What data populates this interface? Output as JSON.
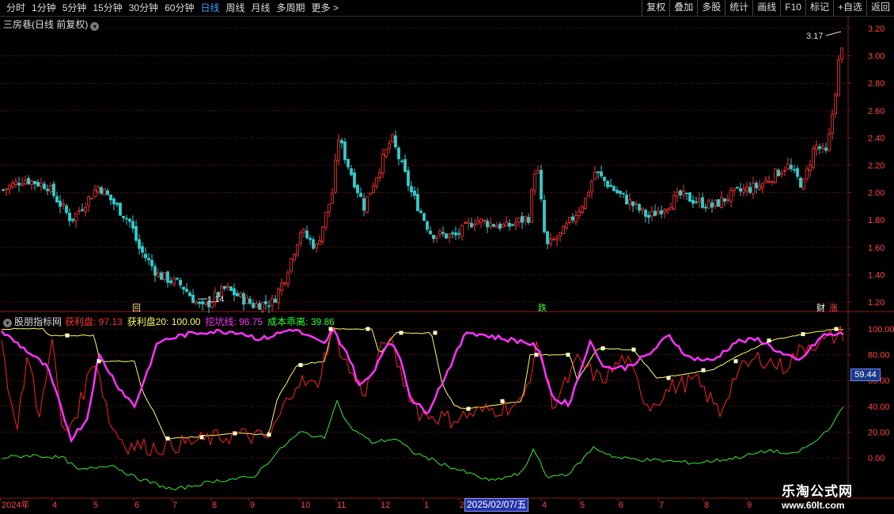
{
  "toolbar": {
    "periods": [
      "分时",
      "1分钟",
      "5分钟",
      "15分钟",
      "30分钟",
      "60分钟",
      "日线",
      "周线",
      "月线",
      "多周期",
      "更多 >"
    ],
    "active_period": "日线",
    "right_buttons": [
      "复权",
      "叠加",
      "多股",
      "统计",
      "画线",
      "F10",
      "标记",
      "+自选",
      "返回"
    ]
  },
  "stock": {
    "title": "三房巷(日线 前复权)"
  },
  "price_axis": {
    "ticks": [
      "3.20",
      "3.00",
      "2.80",
      "2.60",
      "2.40",
      "2.20",
      "2.00",
      "1.80",
      "1.60",
      "1.40",
      "1.20"
    ]
  },
  "annotations": {
    "high_label": "3.17",
    "low_label": "1.14",
    "event_labels": [
      {
        "text": "回",
        "color": "#ffdd88"
      },
      {
        "text": "跌",
        "color": "#44ff44"
      },
      {
        "text": "财",
        "color": "#ffffff"
      },
      {
        "text": "涨",
        "color": "#ff4444"
      }
    ]
  },
  "indicator": {
    "name": "股朋指标网",
    "items": [
      {
        "label": "获利盘: 97.13",
        "color": "#ff3333"
      },
      {
        "label": "获利盘20: 100.00",
        "color": "#ffff66"
      },
      {
        "label": "挖坑线: 96.75",
        "color": "#ff33ff"
      },
      {
        "label": "成本乖离: 39.86",
        "color": "#33ff33"
      }
    ],
    "axis_ticks": [
      "100.00",
      "80.00",
      "60.00",
      "40.00",
      "20.00",
      "0.00"
    ],
    "current_value": "59.44"
  },
  "time_axis": {
    "labels": [
      "2024年",
      "4",
      "5",
      "6",
      "7",
      "8",
      "9",
      "10",
      "11",
      "12",
      "1",
      "2",
      "2025/02/07/五",
      "4",
      "5",
      "6",
      "7",
      "8",
      "9"
    ]
  },
  "watermark": {
    "line1": "乐淘公式网",
    "line2": "www.60lt.com"
  },
  "colors": {
    "up": "#ff3333",
    "down": "#33cccc",
    "grid": "#8b1a1a"
  }
}
